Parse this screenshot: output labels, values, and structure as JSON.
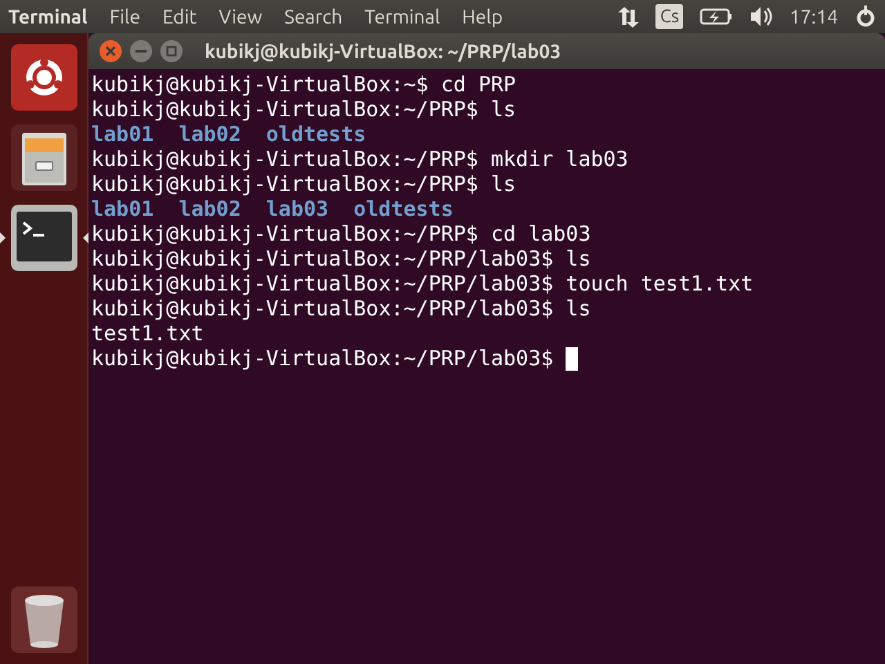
{
  "top_bar": {
    "app_name": "Terminal",
    "menu": [
      "File",
      "Edit",
      "View",
      "Search",
      "Terminal",
      "Help"
    ],
    "keyboard_layout": "Cs",
    "clock": "17:14"
  },
  "launcher": {
    "items": [
      {
        "kind": "dash",
        "running": false
      },
      {
        "kind": "files",
        "running": false
      },
      {
        "kind": "terminal",
        "running": true
      }
    ],
    "trash": {
      "kind": "trash"
    }
  },
  "window": {
    "title": "kubikj@kubikj-VirtualBox: ~/PRP/lab03",
    "lines": [
      {
        "kind": "command",
        "text": "kubikj@kubikj-VirtualBox:~$ cd PRP"
      },
      {
        "kind": "command",
        "text": "kubikj@kubikj-VirtualBox:~/PRP$ ls"
      },
      {
        "kind": "listing",
        "items": [
          "lab01",
          "lab02",
          "oldtests"
        ]
      },
      {
        "kind": "command",
        "text": "kubikj@kubikj-VirtualBox:~/PRP$ mkdir lab03"
      },
      {
        "kind": "command",
        "text": "kubikj@kubikj-VirtualBox:~/PRP$ ls"
      },
      {
        "kind": "listing",
        "items": [
          "lab01",
          "lab02",
          "lab03",
          "oldtests"
        ]
      },
      {
        "kind": "command",
        "text": "kubikj@kubikj-VirtualBox:~/PRP$ cd lab03"
      },
      {
        "kind": "command",
        "text": "kubikj@kubikj-VirtualBox:~/PRP/lab03$ ls"
      },
      {
        "kind": "command",
        "text": "kubikj@kubikj-VirtualBox:~/PRP/lab03$ touch test1.txt"
      },
      {
        "kind": "command",
        "text": "kubikj@kubikj-VirtualBox:~/PRP/lab03$ ls"
      },
      {
        "kind": "output",
        "text": "test1.txt"
      },
      {
        "kind": "command",
        "text": "kubikj@kubikj-VirtualBox:~/PRP/lab03$",
        "cursor": true
      }
    ]
  }
}
